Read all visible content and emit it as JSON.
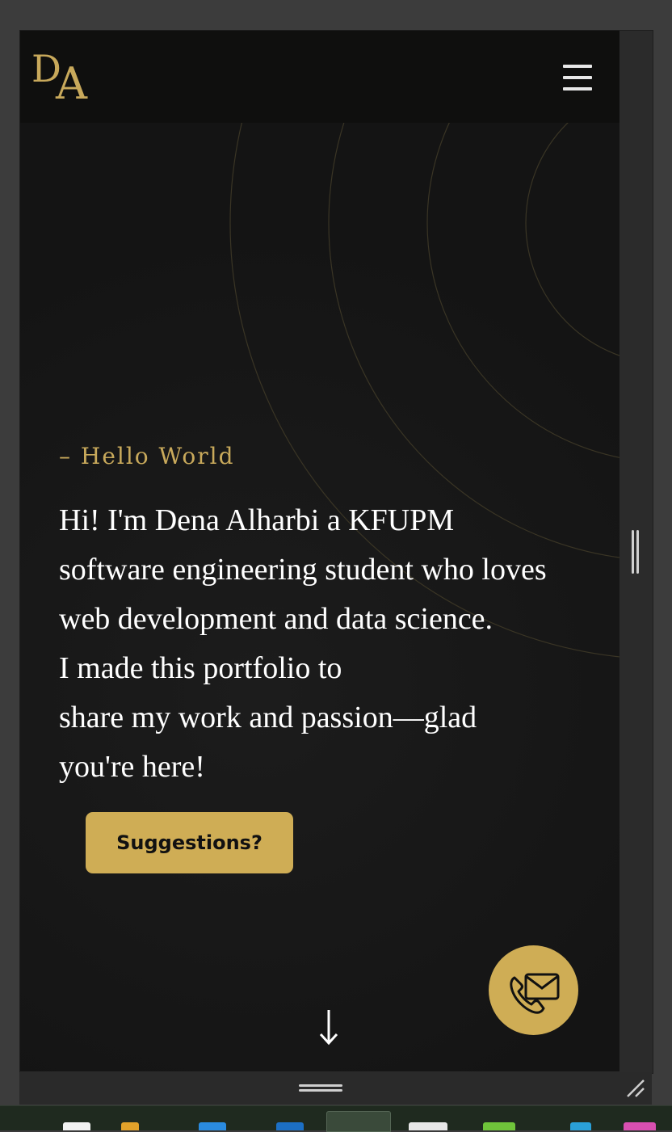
{
  "header": {
    "logo_letter_1": "D",
    "logo_letter_2": "A",
    "menu_icon": "hamburger-icon"
  },
  "hero": {
    "eyebrow": "– Hello World",
    "intro_lines": [
      "Hi! I'm Dena Alharbi a KFUPM",
      "software engineering student who loves",
      "web development and data science.",
      "I made this portfolio to",
      "share my work and passion—glad",
      "you're here!"
    ],
    "suggestions_label": "Suggestions?",
    "contact_icon": "phone-mail-icon",
    "scroll_icon": "down-arrow-icon"
  },
  "colors": {
    "accent_gold": "#cfad55",
    "logo_gold": "#c8a95b",
    "background": "#151515",
    "header_bg": "#0f0f0e",
    "text": "#ffffff"
  }
}
